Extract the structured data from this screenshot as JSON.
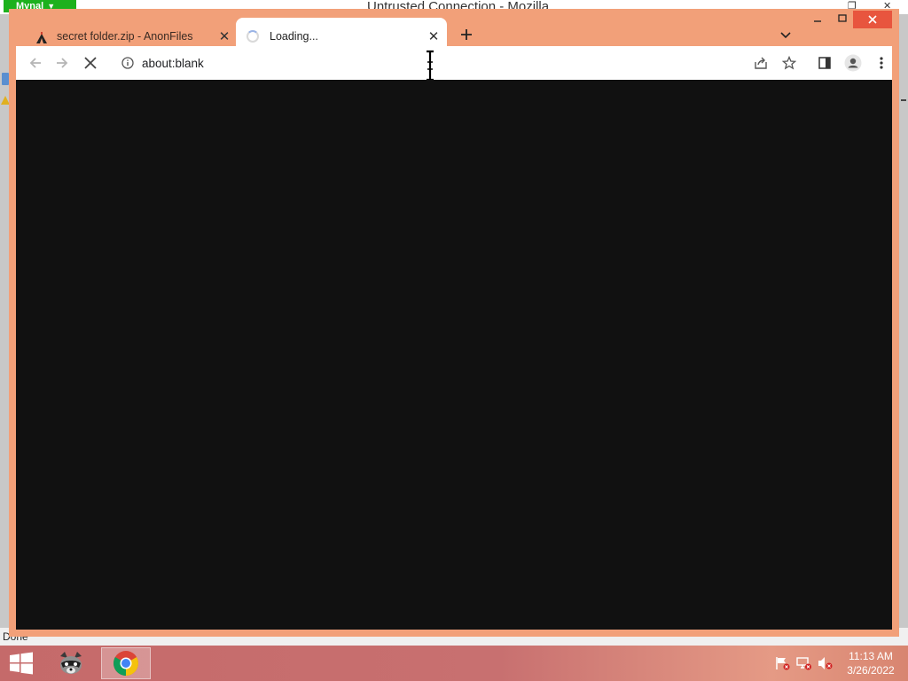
{
  "background_window": {
    "app_button_label": "Mynal",
    "title_text": "Untrusted Connection - Mozilla",
    "status_text": "Done"
  },
  "browser": {
    "tabs": [
      {
        "title": "secret folder.zip - AnonFiles",
        "active": false,
        "favicon": "anonfiles-icon"
      },
      {
        "title": "Loading...",
        "active": true,
        "favicon": "loading-spinner-icon"
      }
    ],
    "address_bar": {
      "url": "about:blank"
    },
    "theme_color": "#f2a079",
    "content_background": "#111111"
  },
  "taskbar": {
    "apps": [
      {
        "name": "raccoon-app-icon",
        "active": false
      },
      {
        "name": "chrome-app-icon",
        "active": true
      }
    ],
    "clock": {
      "time": "11:13 AM",
      "date": "3/26/2022"
    }
  }
}
